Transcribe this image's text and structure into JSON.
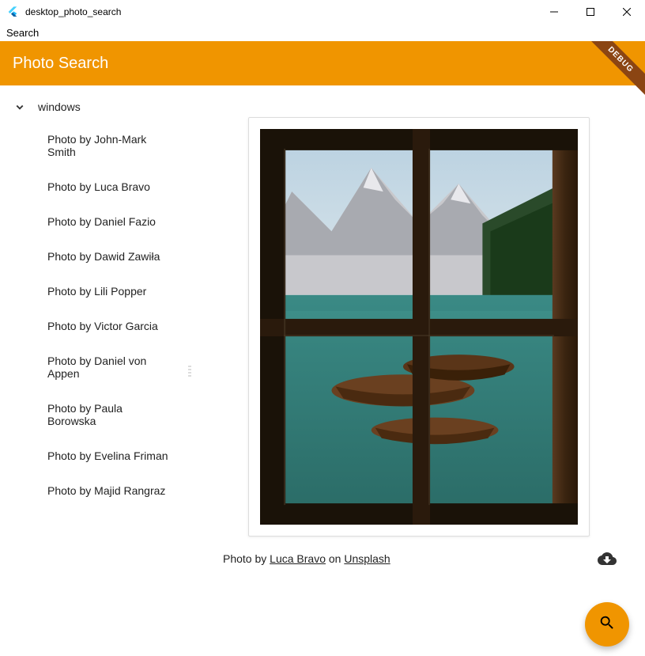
{
  "window": {
    "title": "desktop_photo_search"
  },
  "menu": {
    "search": "Search"
  },
  "appbar": {
    "title": "Photo Search",
    "debug": "DEBUG"
  },
  "sidebar": {
    "query": "windows",
    "items": [
      {
        "label": "Photo by John-Mark Smith"
      },
      {
        "label": "Photo by Luca Bravo"
      },
      {
        "label": "Photo by Daniel Fazio"
      },
      {
        "label": "Photo by Dawid Zawiła"
      },
      {
        "label": "Photo by Lili Popper"
      },
      {
        "label": "Photo by Victor Garcia"
      },
      {
        "label": "Photo by Daniel von Appen"
      },
      {
        "label": "Photo by Paula Borowska"
      },
      {
        "label": "Photo by Evelina Friman"
      },
      {
        "label": "Photo by Majid Rangraz"
      }
    ]
  },
  "detail": {
    "caption_prefix": "Photo by ",
    "author": "Luca Bravo",
    "caption_mid": " on ",
    "source": "Unsplash"
  },
  "colors": {
    "accent": "#F09500"
  }
}
